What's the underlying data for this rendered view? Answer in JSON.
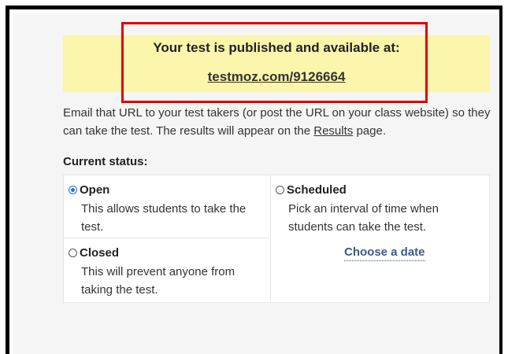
{
  "banner": {
    "title": "Your test is published and available at:",
    "url": "testmoz.com/9126664"
  },
  "instructions": {
    "before_link": "Email that URL to your test takers (or post the URL on your class website) so they can take the test. The results will appear on the ",
    "link": "Results",
    "after_link": " page."
  },
  "status": {
    "label": "Current status:",
    "options": [
      {
        "label": "Open",
        "description": "This allows students to take the test.",
        "selected": true
      },
      {
        "label": "Closed",
        "description": "This will prevent anyone from taking the test.",
        "selected": false
      },
      {
        "label": "Scheduled",
        "description": "Pick an interval of time when students can take the test.",
        "selected": false
      }
    ],
    "choose_date": "Choose a date"
  },
  "colors": {
    "banner_bg": "#fbf6ab",
    "highlight_border": "#e00000",
    "radio_selected": "#1a73e8"
  }
}
